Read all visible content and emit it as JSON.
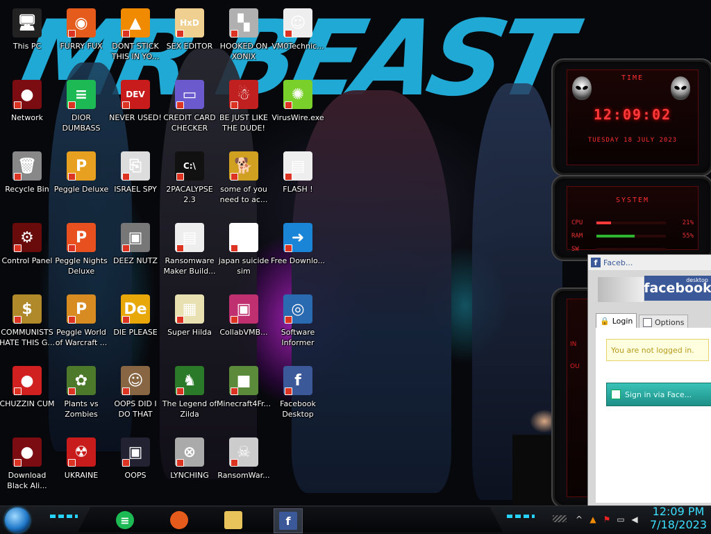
{
  "wallpaper": {
    "banner_text": "MR BEAST"
  },
  "desktop_icons": [
    {
      "id": "this-pc",
      "label": "This PC",
      "icon": "computer-icon",
      "color": "#222",
      "glyph": "🖥"
    },
    {
      "id": "network",
      "label": "Network",
      "icon": "alien-network-icon",
      "color": "#7a0c12",
      "glyph": "●"
    },
    {
      "id": "recycle-bin",
      "label": "Recycle Bin",
      "icon": "recycle-bin-icon",
      "color": "#888",
      "glyph": "🗑"
    },
    {
      "id": "control-panel",
      "label": "Control Panel",
      "icon": "control-panel-icon",
      "color": "#6a0b0b",
      "glyph": "⚙"
    },
    {
      "id": "communists",
      "label": "COMMUNISTS HATE THIS G...",
      "icon": "money-bag-icon",
      "color": "#b08a2a",
      "glyph": "$"
    },
    {
      "id": "chuzzin-cum",
      "label": "CHUZZIN CUM",
      "icon": "chuzzle-icon",
      "color": "#d02020",
      "glyph": "●"
    },
    {
      "id": "download-black",
      "label": "Download Black Ali...",
      "icon": "alien-download-icon",
      "color": "#7a0c12",
      "glyph": "●"
    },
    {
      "id": "furry-fux",
      "label": "FURRY FUX",
      "icon": "firefox-icon",
      "color": "#e55b1b",
      "glyph": "◉"
    },
    {
      "id": "dior-dumbass",
      "label": "DIOR DUMBASS",
      "icon": "spotify-icon",
      "color": "#1db954",
      "glyph": "≡"
    },
    {
      "id": "peggle-deluxe",
      "label": "Peggle Deluxe",
      "icon": "peggle-icon",
      "color": "#e8a020",
      "glyph": "P"
    },
    {
      "id": "peggle-nights",
      "label": "Peggle Nights Deluxe",
      "icon": "peggle-nights-icon",
      "color": "#e85020",
      "glyph": "P"
    },
    {
      "id": "peggle-world",
      "label": "Peggle World of Warcraft ...",
      "icon": "peggle-wow-icon",
      "color": "#d78b20",
      "glyph": "P"
    },
    {
      "id": "plants-zombies",
      "label": "Plants vs Zombies",
      "icon": "pvz-icon",
      "color": "#4d7a2a",
      "glyph": "✿"
    },
    {
      "id": "ukraine",
      "label": "UKRAINE",
      "icon": "radiation-icon",
      "color": "#c81c1c",
      "glyph": "☢"
    },
    {
      "id": "dont-stick",
      "label": "DONT STICK THIS IN YO...",
      "icon": "vlc-icon",
      "color": "#f08a00",
      "glyph": "▲"
    },
    {
      "id": "never-used",
      "label": "NEVER USED!",
      "icon": "dev-icon",
      "color": "#c81c1c",
      "glyph": "DEV"
    },
    {
      "id": "israel-spy",
      "label": "ISRAEL SPY",
      "icon": "network-spy-icon",
      "color": "#ddd",
      "glyph": "⎘"
    },
    {
      "id": "deez-nutz",
      "label": "DEEZ NUTZ",
      "icon": "windows-stack-icon",
      "color": "#777",
      "glyph": "▣"
    },
    {
      "id": "die-please",
      "label": "DIE PLEASE",
      "icon": "de-icon",
      "color": "#e8a80a",
      "glyph": "De"
    },
    {
      "id": "oops-did",
      "label": "OOPS DID I DO THAT",
      "icon": "portrait-icon",
      "color": "#886644",
      "glyph": "☺"
    },
    {
      "id": "oops",
      "label": "OOPS",
      "icon": "monitor-icon",
      "color": "#223",
      "glyph": "▣"
    },
    {
      "id": "sex-editor",
      "label": "SEX EDITOR",
      "icon": "hxd-icon",
      "color": "#f0d090",
      "glyph": "HxD"
    },
    {
      "id": "credit-card",
      "label": "CREDIT CARD CHECKER",
      "icon": "credit-card-icon",
      "color": "#6a5acd",
      "glyph": "▭"
    },
    {
      "id": "2pacalypse",
      "label": "2PACALYPSE 2.3",
      "icon": "terminal-icon",
      "color": "#111",
      "glyph": "C:\\"
    },
    {
      "id": "ransomware-maker",
      "label": "Ransomware Maker Build...",
      "icon": "window-app-icon",
      "color": "#eee",
      "glyph": "▤"
    },
    {
      "id": "super-hilda",
      "label": "Super Hilda",
      "icon": "pixel-art-icon",
      "color": "#e8e0b0",
      "glyph": "▦"
    },
    {
      "id": "legend-zilda",
      "label": "The Legend of Zilda",
      "icon": "link-sprite-icon",
      "color": "#2a7a2a",
      "glyph": "♞"
    },
    {
      "id": "lynching",
      "label": "LYNCHING",
      "icon": "noose-icon",
      "color": "#aaa",
      "glyph": "⊗"
    },
    {
      "id": "hooked-xonix",
      "label": "HOOKED ON XONIX",
      "icon": "xonix-icon",
      "color": "#b0b0b0",
      "glyph": "▚"
    },
    {
      "id": "be-just-like",
      "label": "BE JUST LIKE THE DUDE!",
      "icon": "santa-icon",
      "color": "#c02020",
      "glyph": "☃"
    },
    {
      "id": "some-of-you",
      "label": "some of you need to ac...",
      "icon": "dog-icon",
      "color": "#d0a020",
      "glyph": "🐕"
    },
    {
      "id": "japan-suicide",
      "label": "japan suicide sim",
      "icon": "document-icon",
      "color": "#fff",
      "glyph": "≡"
    },
    {
      "id": "collabvmb",
      "label": "CollabVMB...",
      "icon": "vm-monitor-icon",
      "color": "#c03070",
      "glyph": "▣"
    },
    {
      "id": "minecraft",
      "label": "Minecraft4Fr...",
      "icon": "grass-block-icon",
      "color": "#5a8a3a",
      "glyph": "■"
    },
    {
      "id": "ransomwar",
      "label": "RansomWar...",
      "icon": "skull-icon",
      "color": "#ccc",
      "glyph": "☠"
    },
    {
      "id": "vm0",
      "label": "VM0Technic...",
      "icon": "doctor-icon",
      "color": "#eee",
      "glyph": "☺"
    },
    {
      "id": "viruswire",
      "label": "VirusWire.exe",
      "icon": "lime-icon",
      "color": "#7ad02a",
      "glyph": "✺"
    },
    {
      "id": "flash",
      "label": "FLASH !",
      "icon": "flash-cards-icon",
      "color": "#eee",
      "glyph": "▤"
    },
    {
      "id": "free-download",
      "label": "Free Downlo...",
      "icon": "arrow-download-icon",
      "color": "#1a84d6",
      "glyph": "➜"
    },
    {
      "id": "software-informer",
      "label": "Software Informer",
      "icon": "magnifier-icon",
      "color": "#2a6ab0",
      "glyph": "◎"
    },
    {
      "id": "facebook-desktop",
      "label": "Facebook Desktop",
      "icon": "facebook-icon",
      "color": "#3b5998",
      "glyph": "f"
    }
  ],
  "gadgets": {
    "time": {
      "title": "TIME",
      "clock": "12:09:02",
      "date": "TUESDAY 18 JULY 2023"
    },
    "system": {
      "title": "SYSTEM",
      "rows": [
        {
          "label": "CPU",
          "value": "21%",
          "fill": 0.21
        },
        {
          "label": "RAM",
          "value": "55%",
          "fill": 0.55
        },
        {
          "label": "SW",
          "value": "",
          "fill": 0
        }
      ]
    },
    "third": {
      "labels": [
        "IN",
        "OU"
      ]
    }
  },
  "facebook_window": {
    "title": "Faceb...",
    "brand_small": "desktop",
    "brand": "facebook",
    "tab_login": "Login",
    "tab_options": "Options",
    "not_logged_msg": "You are not logged in.",
    "sign_in_btn": "Sign in via Face..."
  },
  "taskbar": {
    "apps": [
      {
        "name": "spotify",
        "icon": "spotify-icon",
        "color": "#1db954"
      },
      {
        "name": "firefox",
        "icon": "firefox-icon",
        "color": "#e55b1b"
      },
      {
        "name": "file-explorer",
        "icon": "folder-icon",
        "color": "#e8c25a"
      },
      {
        "name": "facebook",
        "icon": "facebook-icon",
        "color": "#3b5998"
      }
    ],
    "tray": [
      {
        "name": "chevron",
        "icon": "chevron-up-icon",
        "glyph": "^"
      },
      {
        "name": "app",
        "icon": "orange-app-icon",
        "glyph": "▲"
      },
      {
        "name": "flag",
        "icon": "action-center-flag-icon",
        "glyph": "⚑"
      },
      {
        "name": "network",
        "icon": "network-icon",
        "glyph": "▭"
      },
      {
        "name": "volume",
        "icon": "speaker-icon",
        "glyph": "◀"
      }
    ],
    "time": "12:09 PM",
    "date": "7/18/2023"
  }
}
